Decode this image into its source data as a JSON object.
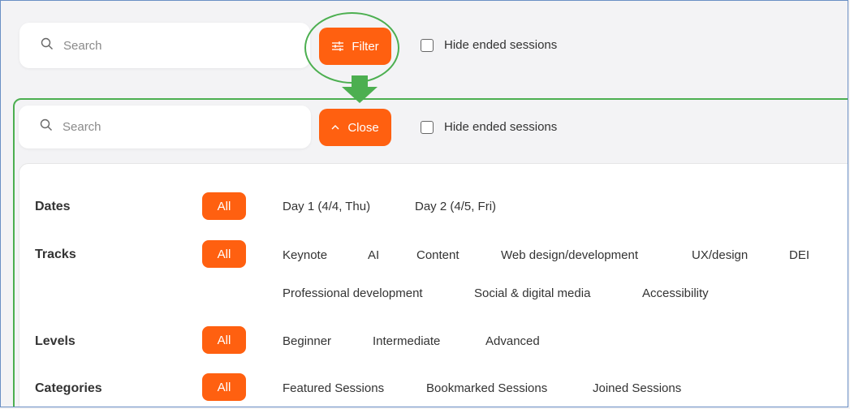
{
  "before": {
    "search_placeholder": "Search",
    "filter_label": "Filter",
    "hide_ended_label": "Hide ended sessions"
  },
  "after": {
    "search_placeholder": "Search",
    "close_label": "Close",
    "hide_ended_label": "Hide ended sessions"
  },
  "filters": {
    "dates": {
      "label": "Dates",
      "all": "All",
      "options": [
        "Day 1 (4/4, Thu)",
        "Day 2 (4/5, Fri)"
      ]
    },
    "tracks": {
      "label": "Tracks",
      "all": "All",
      "options": [
        "Keynote",
        "AI",
        "Content",
        "Web design/development",
        "UX/design",
        "DEI",
        "Professional development",
        "Social & digital media",
        "Accessibility"
      ]
    },
    "levels": {
      "label": "Levels",
      "all": "All",
      "options": [
        "Beginner",
        "Intermediate",
        "Advanced"
      ]
    },
    "categories": {
      "label": "Categories",
      "all": "All",
      "options": [
        "Featured Sessions",
        "Bookmarked Sessions",
        "Joined Sessions"
      ]
    }
  },
  "colors": {
    "accent": "#ff6010",
    "annotation": "#4caf50"
  },
  "icons": {
    "search": "search-icon",
    "filter": "sliders-icon",
    "close": "chevron-up-icon",
    "arrow": "arrow-down-icon"
  }
}
